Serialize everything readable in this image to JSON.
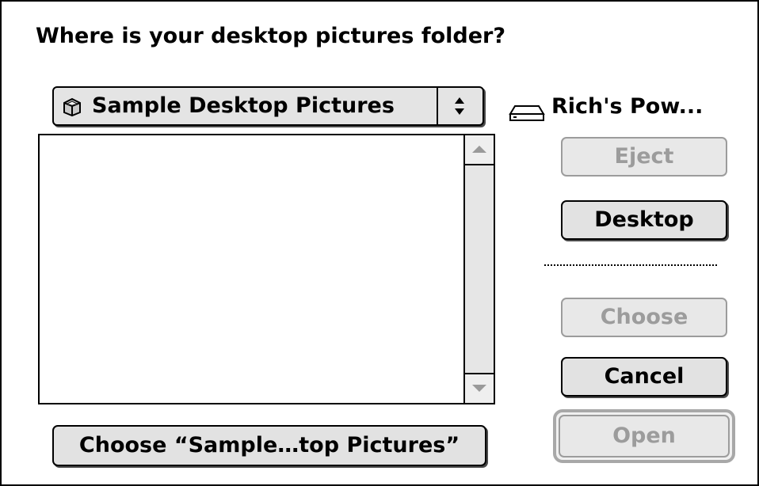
{
  "dialog": {
    "prompt": "Where is your desktop pictures folder?"
  },
  "location_popup": {
    "icon": "folder-icon",
    "label": "Sample Desktop Pictures"
  },
  "volume": {
    "icon": "hard-disk-icon",
    "name": "Rich's Pow..."
  },
  "file_list": {
    "items": []
  },
  "buttons": {
    "eject": "Eject",
    "desktop": "Desktop",
    "choose": "Choose",
    "cancel": "Cancel",
    "open": "Open",
    "choose_folder": "Choose “Sample…top Pictures”"
  },
  "colors": {
    "button_face": "#e2e2e2",
    "disabled_text": "#9c9c9c",
    "scrollbar_track": "#e6e6e6"
  }
}
